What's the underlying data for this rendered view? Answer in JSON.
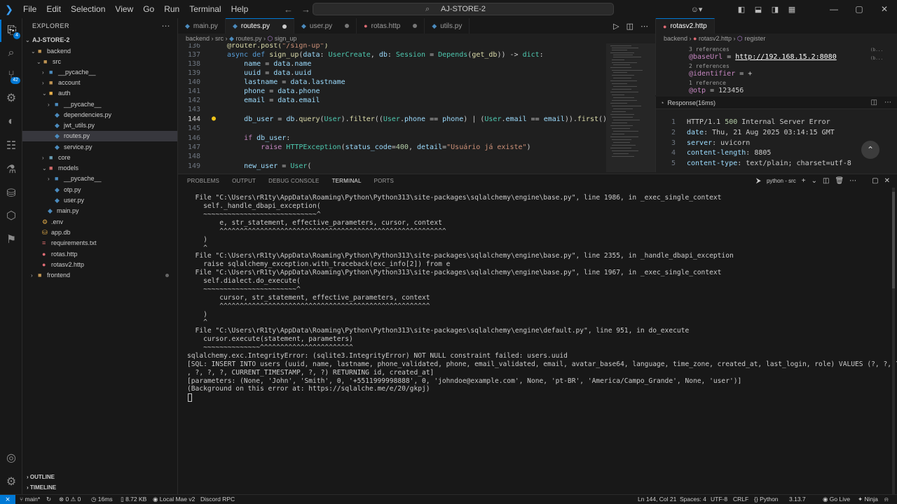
{
  "titlebar": {
    "menu": [
      "File",
      "Edit",
      "Selection",
      "View",
      "Go",
      "Run",
      "Terminal",
      "Help"
    ],
    "search": "AJ-STORE-2"
  },
  "activity": {
    "explorer_badge": "4",
    "scm_badge": "42"
  },
  "sidebar": {
    "title": "EXPLORER",
    "root": "AJ-STORE-2",
    "items": [
      {
        "label": "backend",
        "type": "folder"
      },
      {
        "label": "src",
        "type": "folder"
      },
      {
        "label": "__pycache__",
        "type": "folder"
      },
      {
        "label": "account",
        "type": "folder"
      },
      {
        "label": "auth",
        "type": "folder"
      },
      {
        "label": "__pycache__",
        "type": "folder"
      },
      {
        "label": "dependencies.py",
        "type": "file"
      },
      {
        "label": "jwt_utils.py",
        "type": "file"
      },
      {
        "label": "routes.py",
        "type": "file"
      },
      {
        "label": "service.py",
        "type": "file"
      },
      {
        "label": "core",
        "type": "folder"
      },
      {
        "label": "models",
        "type": "folder"
      },
      {
        "label": "__pycache__",
        "type": "folder"
      },
      {
        "label": "otp.py",
        "type": "file"
      },
      {
        "label": "user.py",
        "type": "file"
      },
      {
        "label": "main.py",
        "type": "file"
      },
      {
        "label": ".env",
        "type": "file"
      },
      {
        "label": "app.db",
        "type": "file"
      },
      {
        "label": "requirements.txt",
        "type": "file"
      },
      {
        "label": "rotas.http",
        "type": "file"
      },
      {
        "label": "rotasv2.http",
        "type": "file"
      },
      {
        "label": "frontend",
        "type": "folder"
      }
    ],
    "outline": "OUTLINE",
    "timeline": "TIMELINE"
  },
  "editor1": {
    "tabs": [
      "main.py",
      "routes.py",
      "user.py",
      "rotas.http",
      "utils.py"
    ],
    "breadcrumb": [
      "backend",
      "src",
      "routes.py",
      "sign_up"
    ],
    "lines": [
      {
        "n": "136",
        "text": "@router.post(\"/sign-up\")"
      },
      {
        "n": "137",
        "text": "async def sign_up(data: UserCreate, db: Session = Depends(get_db)) -> dict:"
      },
      {
        "n": "138",
        "text": "    name = data.name"
      },
      {
        "n": "139",
        "text": "    uuid = data.uuid"
      },
      {
        "n": "140",
        "text": "    lastname = data.lastname"
      },
      {
        "n": "141",
        "text": "    phone = data.phone"
      },
      {
        "n": "142",
        "text": "    email = data.email"
      },
      {
        "n": "143",
        "text": ""
      },
      {
        "n": "144",
        "text": "    db_user = db.query(User).filter((User.phone == phone) | (User.email == email)).first()"
      },
      {
        "n": "145",
        "text": ""
      },
      {
        "n": "146",
        "text": "    if db_user:"
      },
      {
        "n": "147",
        "text": "        raise HTTPException(status_code=400, detail=\"Usuário já existe\")"
      },
      {
        "n": "148",
        "text": ""
      },
      {
        "n": "149",
        "text": "    new_user = User("
      }
    ]
  },
  "editor2": {
    "tab": "rotasv2.http",
    "breadcrumb": [
      "backend",
      "rotasv2.http",
      "register"
    ],
    "lens1": "3 references",
    "var1_name": "@baseUrl",
    "var1_value": "http://192.168.15.2:8080",
    "lens2": "2 references",
    "var2_name": "@identifier",
    "var2_value": "+",
    "lens3": "1 reference",
    "var3_name": "@otp",
    "var3_value": "123456"
  },
  "response": {
    "title": "Response(16ms)",
    "lines": [
      {
        "n": "1",
        "key": "HTTP/1.1 ",
        "status": "500",
        "val": " Internal Server Error"
      },
      {
        "n": "2",
        "key": "date",
        "val": ": Thu, 21 Aug 2025 03:14:15 GMT"
      },
      {
        "n": "3",
        "key": "server",
        "val": ": uvicorn"
      },
      {
        "n": "4",
        "key": "content-length",
        "val": ": 8805"
      },
      {
        "n": "5",
        "key": "content-type",
        "val": ": text/plain; charset=utf-8"
      }
    ]
  },
  "panel": {
    "tabs": [
      "PROBLEMS",
      "OUTPUT",
      "DEBUG CONSOLE",
      "TERMINAL",
      "PORTS"
    ],
    "active_tab": "TERMINAL",
    "terminal_name": "python - src"
  },
  "terminal": {
    "lines": [
      "  File \"C:\\Users\\rR1ty\\AppData\\Roaming\\Python\\Python313\\site-packages\\sqlalchemy\\engine\\base.py\", line 1986, in _exec_single_context",
      "    self._handle_dbapi_exception(",
      "    ~~~~~~~~~~~~~~~~~~~~~~~~~~~~^",
      "        e, str_statement, effective_parameters, cursor, context",
      "        ^^^^^^^^^^^^^^^^^^^^^^^^^^^^^^^^^^^^^^^^^^^^^^^^^^^^^^^^",
      "    )",
      "    ^",
      "  File \"C:\\Users\\rR1ty\\AppData\\Roaming\\Python\\Python313\\site-packages\\sqlalchemy\\engine\\base.py\", line 2355, in _handle_dbapi_exception",
      "    raise sqlalchemy_exception.with_traceback(exc_info[2]) from e",
      "  File \"C:\\Users\\rR1ty\\AppData\\Roaming\\Python\\Python313\\site-packages\\sqlalchemy\\engine\\base.py\", line 1967, in _exec_single_context",
      "    self.dialect.do_execute(",
      "    ~~~~~~~~~~~~~~~~~~~~~~~^",
      "        cursor, str_statement, effective_parameters, context",
      "        ^^^^^^^^^^^^^^^^^^^^^^^^^^^^^^^^^^^^^^^^^^^^^^^^^^^^",
      "    )",
      "    ^",
      "  File \"C:\\Users\\rR1ty\\AppData\\Roaming\\Python\\Python313\\site-packages\\sqlalchemy\\engine\\default.py\", line 951, in do_execute",
      "    cursor.execute(statement, parameters)",
      "    ~~~~~~~~~~~~~~^^^^^^^^^^^^^^^^^^^^^^^",
      "sqlalchemy.exc.IntegrityError: (sqlite3.IntegrityError) NOT NULL constraint failed: users.uuid",
      "[SQL: INSERT INTO users (uuid, name, lastname, phone_validated, phone, email_validated, email, avatar_base64, language, time_zone, created_at, last_login, role) VALUES (?, ?, ?, ?, ?, ?, ?",
      ", ?, ?, ?, CURRENT_TIMESTAMP, ?, ?) RETURNING id, created_at]",
      "[parameters: (None, 'John', 'Smith', 0, '+5511999998888', 0, 'johndoe@example.com', None, 'pt-BR', 'America/Campo_Grande', None, 'user')]",
      "(Background on this error at: https://sqlalche.me/e/20/gkpj)"
    ]
  },
  "statusbar": {
    "branch": "main*",
    "errors": "0",
    "warnings": "0",
    "timer": "16ms",
    "size": "8.72 KB",
    "local": "Local Mae v2",
    "discord": "Discord RPC",
    "position": "Ln 144, Col 21",
    "spaces": "Spaces: 4",
    "encoding": "UTF-8",
    "eol": "CRLF",
    "language": "Python",
    "version": "3.13.7",
    "golive": "Go Live",
    "ninja": "Ninja"
  }
}
